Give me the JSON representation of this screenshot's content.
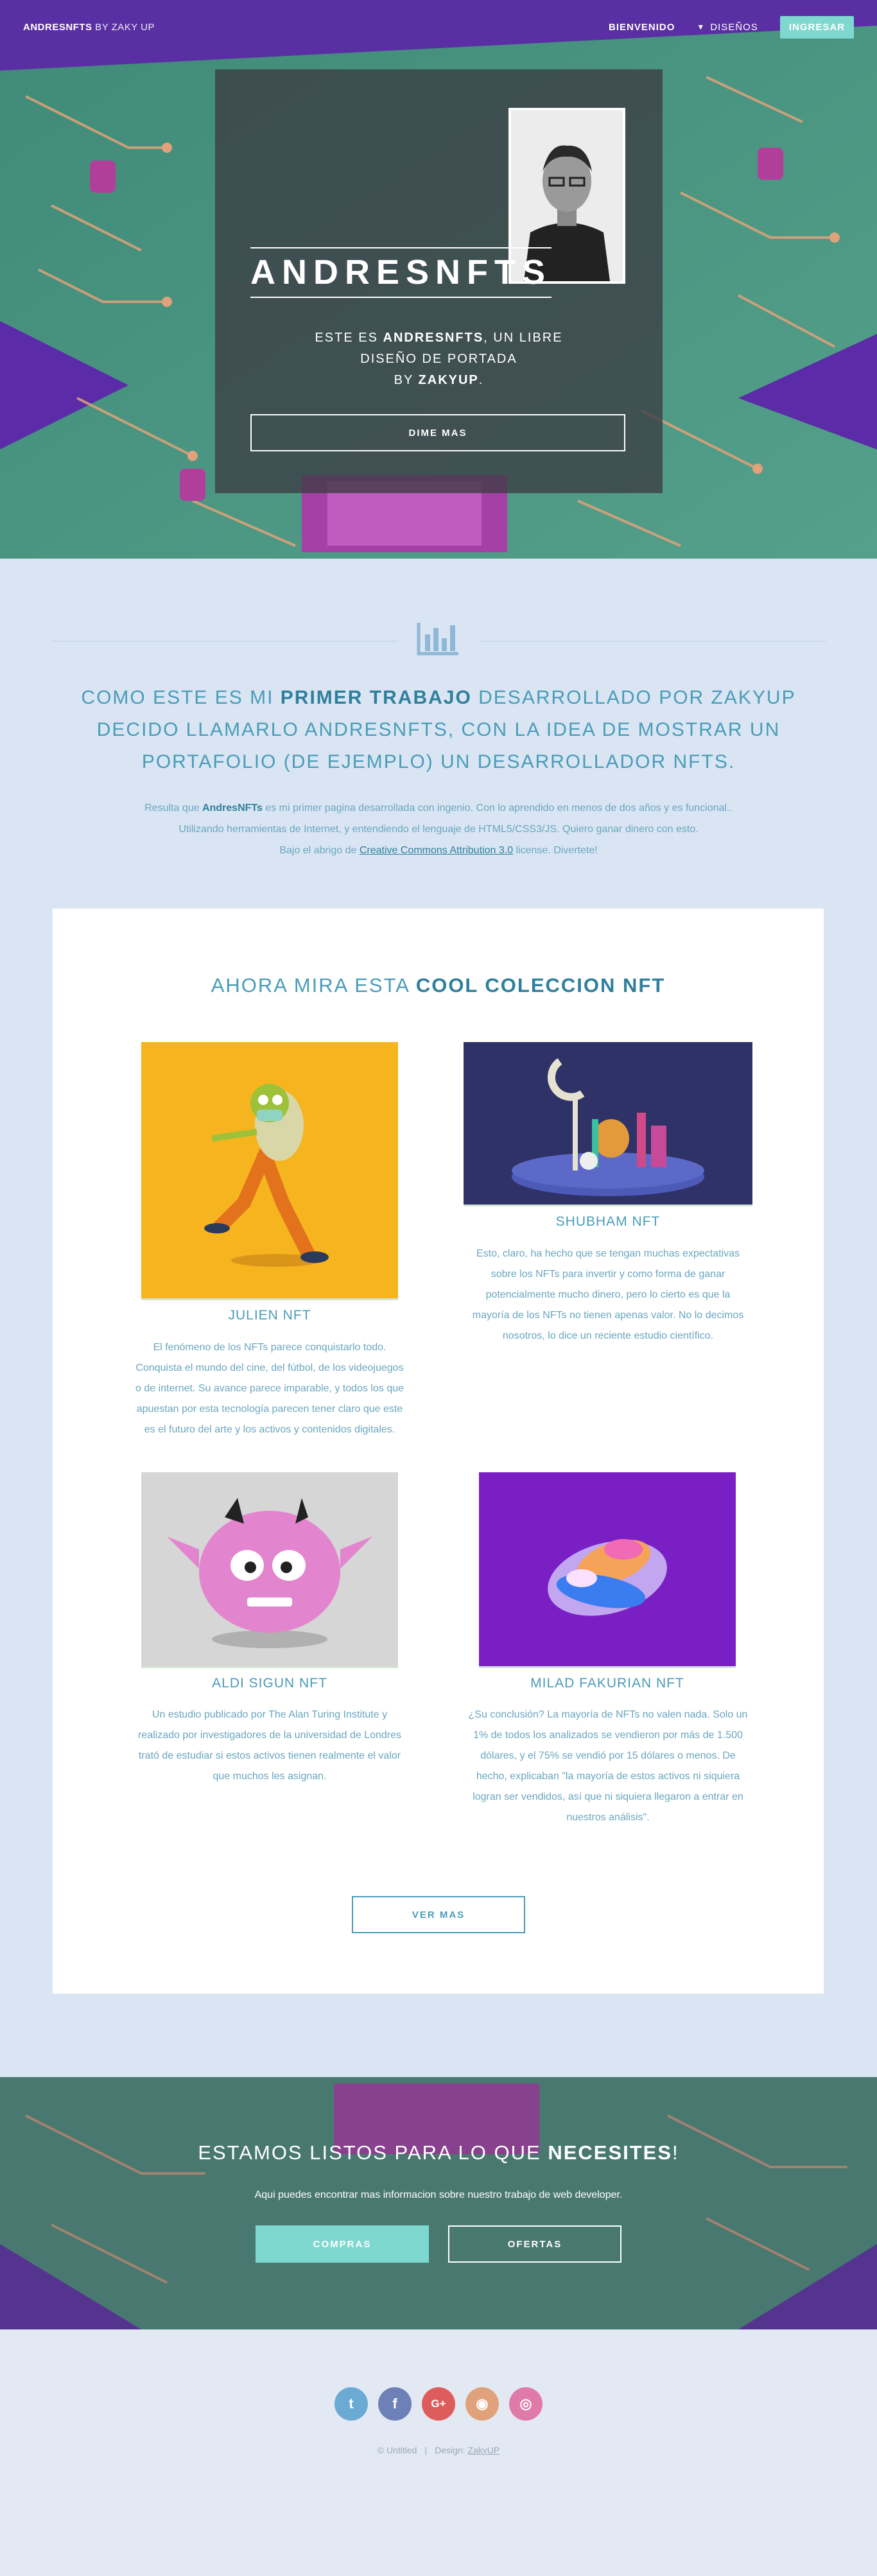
{
  "header": {
    "brand_strong": "ANDRESNFTS",
    "brand_rest": " BY ZAKY UP",
    "nav_home": "BIENVENIDO",
    "nav_designs": "DISEÑOS",
    "login": "INGRESAR"
  },
  "hero": {
    "title": "ANDRESNFTS",
    "sub_line1_a": "ESTE ES ",
    "sub_line1_b": "ANDRESNFTS",
    "sub_line1_c": ", UN LIBRE",
    "sub_line2": "DISEÑO DE PORTADA",
    "sub_line3_a": "BY ",
    "sub_line3_b": "ZAKYUP",
    "sub_line3_c": ".",
    "cta": "DIME MAS"
  },
  "intro": {
    "heading_a": "COMO ESTE ES MI ",
    "heading_b": "PRIMER TRABAJO",
    "heading_c": " DESARROLLADO POR ZAKYUP",
    "heading_line2": "DECIDO LLAMARLO ANDRESNFTS, CON LA IDEA DE MOSTRAR UN",
    "heading_line3": "PORTAFOLIO (DE EJEMPLO) UN DESARROLLADOR NFTS.",
    "text_a": "Resulta que ",
    "text_b": "AndresNFTs",
    "text_c": " es mi primer pagina desarrollada con ingenio. Con lo aprendido en menos de dos años y es funcional..",
    "text_line2": "Utilizando herramientas de Internet, y entendiendo el lenguaje de HTML5/CSS3/JS. Quiero ganar dinero con esto.",
    "text_line3_a": "Bajo el abrigo de ",
    "license": "Creative Commons Attribution 3.0",
    "text_line3_b": " license. Divertete!"
  },
  "gallery": {
    "heading_a": "AHORA MIRA ESTA ",
    "heading_b": "COOL COLECCION NFT",
    "items": [
      {
        "name": "JULIEN NFT",
        "desc": [
          "El fenómeno de los NFTs parece conquistarlo todo.",
          "Conquista el mundo del cine, del fútbol, de los videojuegos",
          "o de internet. Su avance parece imparable, y todos los que",
          "apuestan por esta tecnología parecen tener claro que este",
          "es el futuro del arte y los activos y contenidos digitales."
        ]
      },
      {
        "name": "SHUBHAM NFT",
        "desc": [
          "Esto, claro, ha hecho que se tengan muchas expectativas",
          "sobre los NFTs para invertir y como forma de ganar",
          "potencialmente mucho dinero, pero lo cierto es que la",
          "mayoría de los NFTs no tienen apenas valor. No lo decimos",
          "nosotros, lo dice un reciente estudio científico."
        ]
      },
      {
        "name": "ALDI SIGUN NFT",
        "desc": [
          "Un estudio publicado por The Alan Turing Institute y",
          "realizado por investigadores de la universidad de Londres",
          "trató de estudiar si estos activos tienen realmente el valor",
          "que muchos les asignan."
        ]
      },
      {
        "name": "MILAD FAKURIAN NFT",
        "desc": [
          "¿Su conclusión? La mayoría de NFTs no valen nada. Solo un",
          "1% de todos los analizados se vendieron por más de 1.500",
          "dólares, y el 75% se vendió por 15 dólares o menos. De",
          "hecho, explicaban \"la mayoría de estos activos ni siquiera",
          "logran ser vendidos, así que ni siquiera llegaron a entrar en",
          "nuestros análisis\"."
        ]
      }
    ],
    "more": "VER MAS"
  },
  "cta": {
    "heading_a": "ESTAMOS LISTOS PARA LO QUE ",
    "heading_b": "NECESITES",
    "heading_c": "!",
    "text": "Aqui puedes encontrar mas informacion sobre nuestro trabajo de web developer.",
    "buy": "COMPRAS",
    "offers": "OFERTAS"
  },
  "footer": {
    "social": [
      {
        "icon": "twitter-icon",
        "glyph": "t",
        "color": "#6aaad3"
      },
      {
        "icon": "facebook-icon",
        "glyph": "f",
        "color": "#6d80b8"
      },
      {
        "icon": "google-plus-icon",
        "glyph": "G+",
        "color": "#df5c5c"
      },
      {
        "icon": "github-icon",
        "glyph": "◉",
        "color": "#e0a27a"
      },
      {
        "icon": "dribbble-icon",
        "glyph": "◎",
        "color": "#e07aa8"
      }
    ],
    "copyright": "© Untitled",
    "design_label": "Design: ",
    "design_link": "ZakyUP"
  }
}
